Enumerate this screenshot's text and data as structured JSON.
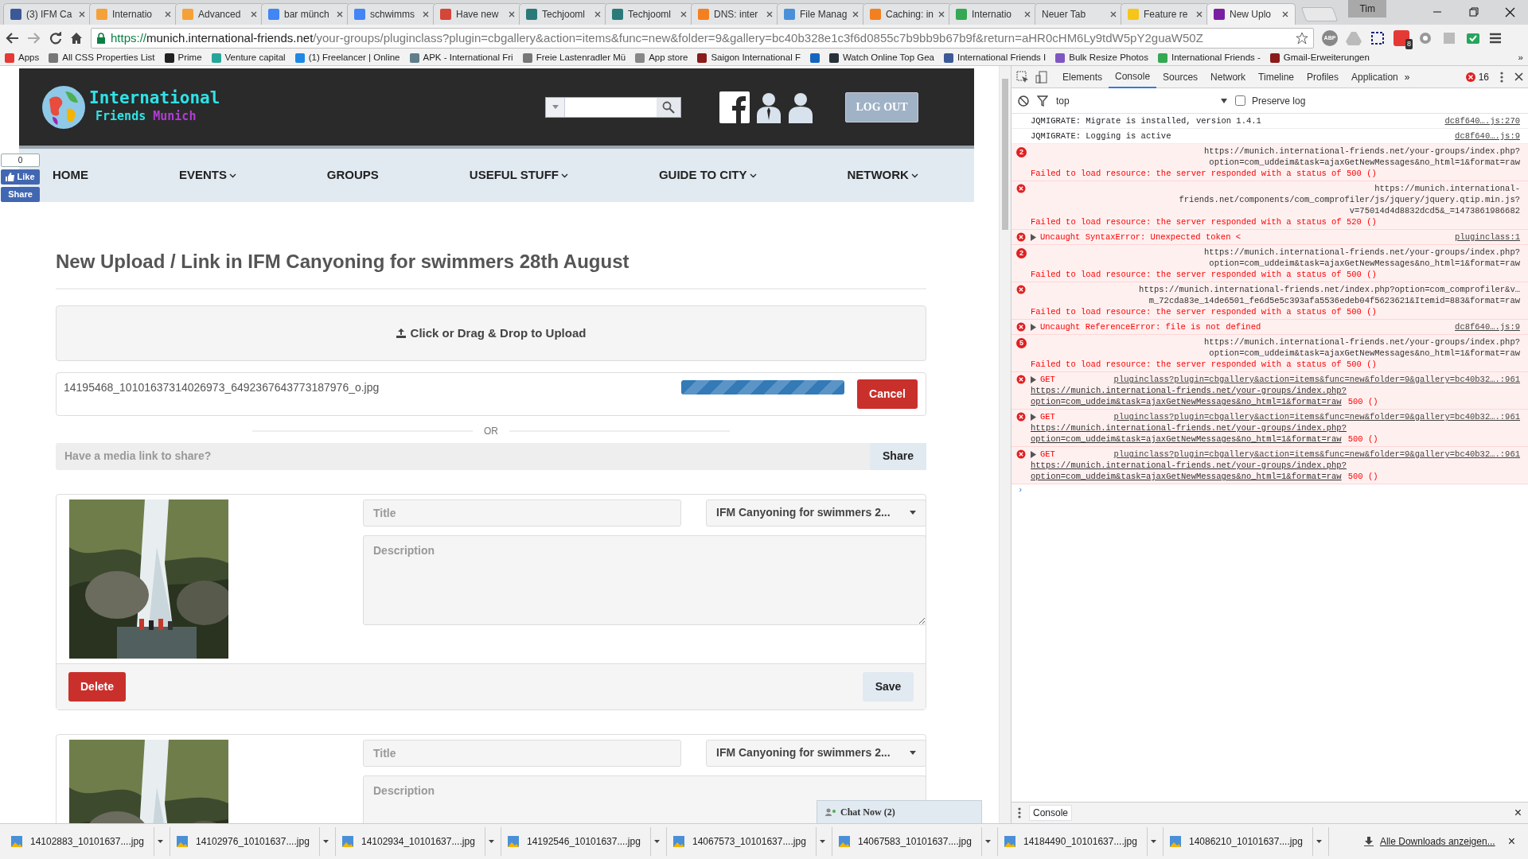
{
  "browser": {
    "tabs": [
      {
        "title": "(3) IFM Ca",
        "color": "#3b5998",
        "selected": false
      },
      {
        "title": "Internatio",
        "color": "#f4a13a",
        "selected": false
      },
      {
        "title": "Advanced",
        "color": "#f4a13a",
        "selected": false
      },
      {
        "title": "bar münch",
        "color": "#4285f4",
        "selected": false
      },
      {
        "title": "schwimms",
        "color": "#4285f4",
        "selected": false
      },
      {
        "title": "Have new",
        "color": "#d44638",
        "selected": false
      },
      {
        "title": "Techjooml",
        "color": "#2a7a7a",
        "selected": false
      },
      {
        "title": "Techjooml",
        "color": "#2a7a7a",
        "selected": false
      },
      {
        "title": "DNS: inter",
        "color": "#f38020",
        "selected": false
      },
      {
        "title": "File Manag",
        "color": "#4a90d9",
        "selected": false
      },
      {
        "title": "Caching: in",
        "color": "#f38020",
        "selected": false
      },
      {
        "title": "Internatio",
        "color": "#34a853",
        "selected": false
      },
      {
        "title": "Neuer Tab",
        "selected": false
      },
      {
        "title": "Feature re",
        "color": "#f5c518",
        "selected": false
      },
      {
        "title": "New Uplo",
        "color": "#7b1fa2",
        "selected": true
      }
    ],
    "profile": "Tim",
    "url_scheme": "https://",
    "url_host": "munich.international-friends.net",
    "url_path": "/your-groups/pluginclass?plugin=cbgallery&action=items&func=new&folder=9&gallery=bc40b328e1c3f6d0855c7b9bb9b67b9f&return=aHR0cHM6Ly9tdW5pY2guaW50Z",
    "abp_label": "ABP",
    "extension_badge": "8",
    "bookmarks": [
      {
        "title": "Apps",
        "color": "#e53935"
      },
      {
        "title": "All CSS Properties List",
        "color": "#777777"
      },
      {
        "title": "Prime",
        "color": "#222222"
      },
      {
        "title": "Venture capital",
        "color": "#26a69a"
      },
      {
        "title": "(1) Freelancer | Online",
        "color": "#1e88e5"
      },
      {
        "title": "APK - International Fri",
        "color": "#607d8b"
      },
      {
        "title": "Freie Lastenradler Mü",
        "color": "#777777"
      },
      {
        "title": "App store",
        "color": "#888888"
      },
      {
        "title": "Saigon International F",
        "color": "#8b1a1a"
      },
      {
        "color": "#1565c0"
      },
      {
        "title": "Watch Online Top Gea",
        "color": "#263238"
      },
      {
        "title": "International Friends I",
        "color": "#3b5998"
      },
      {
        "title": "Bulk Resize Photos",
        "color": "#7e57c2"
      },
      {
        "title": "International Friends -",
        "color": "#34a853"
      },
      {
        "title": "Gmail-Erweiterungen",
        "color": "#8b1a1a"
      }
    ],
    "bookmarks_more": "»"
  },
  "site": {
    "logo_line1": "International",
    "logo_line2a": "Friends",
    "logo_line2b": "Munich",
    "logout": "LOG OUT",
    "like_count": "0",
    "like": "Like",
    "share": "Share",
    "nav": [
      {
        "label": "HOME",
        "dropdown": false
      },
      {
        "label": "EVENTS",
        "dropdown": true
      },
      {
        "label": "GROUPS",
        "dropdown": false
      },
      {
        "label": "USEFUL STUFF",
        "dropdown": true
      },
      {
        "label": "GUIDE TO CITY",
        "dropdown": true
      },
      {
        "label": "NETWORK",
        "dropdown": true
      }
    ]
  },
  "upload": {
    "title": "New Upload / Link in IFM Canyoning for swimmers 28th August",
    "dropzone": "Click or Drag & Drop to Upload",
    "file": {
      "name": "14195468_10101637314026973_6492367643773187976_o.jpg",
      "level": 1.0,
      "cancel": "Cancel"
    },
    "or": "OR",
    "link_placeholder": "Have a media link to share?",
    "share": "Share",
    "items": [
      {
        "kind": "picture",
        "title_placeholder": "Title",
        "gallery": "IFM Canyoning for swimmers 2...",
        "description_placeholder": "Description",
        "delete": "Delete",
        "save": "Save"
      },
      {
        "kind": "picture",
        "title_placeholder": "Title",
        "gallery": "IFM Canyoning for swimmers 2...",
        "description_placeholder": "Description"
      }
    ],
    "chat": "Chat Now (2)"
  },
  "devtools": {
    "tabs": [
      {
        "label": "Elements",
        "selected": false
      },
      {
        "label": "Console",
        "selected": true
      },
      {
        "label": "Sources",
        "selected": false
      },
      {
        "label": "Network",
        "selected": false
      },
      {
        "label": "Timeline",
        "selected": false
      },
      {
        "label": "Profiles",
        "selected": false
      },
      {
        "label": "Application",
        "selected": false
      }
    ],
    "more": "»",
    "error_count": "16",
    "context": "top",
    "preserve_log": {
      "label": "Preserve log",
      "checked": false
    },
    "messages": [
      {
        "kind": "log",
        "text": "JQMIGRATE: Migrate is installed, version 1.4.1",
        "source": "dc8f640….js:270"
      },
      {
        "kind": "log",
        "text": "JQMIGRATE: Logging is active",
        "source": "dc8f640….js:9"
      },
      {
        "kind": "resource",
        "count": "2",
        "url_lines": [
          "https://munich.international-friends.net/your-groups/index.php?",
          "option=com_uddeim&task=ajaxGetNewMessages&no_html=1&format=raw"
        ],
        "text": "Failed to load resource: the server responded with a status of 500 ()"
      },
      {
        "kind": "resource",
        "url_lines": [
          "https://munich.international-",
          "friends.net/components/com_comprofiler/js/jquery/jquery.qtip.min.js?",
          "v=75014d4d8832dcd5&_=1473861986682"
        ],
        "text": "Failed to load resource: the server responded with a status of 520 ()"
      },
      {
        "kind": "exception",
        "text": "Uncaught SyntaxError: Unexpected token <",
        "source": "pluginclass:1"
      },
      {
        "kind": "resource",
        "count": "2",
        "url_lines": [
          "https://munich.international-friends.net/your-groups/index.php?",
          "option=com_uddeim&task=ajaxGetNewMessages&no_html=1&format=raw"
        ],
        "text": "Failed to load resource: the server responded with a status of 500 ()"
      },
      {
        "kind": "resource",
        "url_lines": [
          "https://munich.international-friends.net/index.php?option=com_comprofiler&v…",
          "m_72cda83e_14de6501_fe6d5e5c393afa5536edeb04f5623621&Itemid=883&format=raw"
        ],
        "text": "Failed to load resource: the server responded with a status of 500 ()"
      },
      {
        "kind": "exception",
        "text": "Uncaught ReferenceError: file is not defined",
        "source": "dc8f640….js:9"
      },
      {
        "kind": "resource",
        "count": "5",
        "url_lines": [
          "https://munich.international-friends.net/your-groups/index.php?",
          "option=com_uddeim&task=ajaxGetNewMessages&no_html=1&format=raw"
        ],
        "text": "Failed to load resource: the server responded with a status of 500 ()"
      },
      {
        "kind": "request",
        "method": "GET",
        "source": "pluginclass?plugin=cbgallery&action=items&func=new&folder=9&gallery=bc40b32….:961",
        "link_lines": [
          "https://munich.international-friends.net/your-groups/index.php?",
          "option=com_uddeim&task=ajaxGetNewMessages&no_html=1&format=raw"
        ],
        "status": "500 ()"
      },
      {
        "kind": "request",
        "method": "GET",
        "source": "pluginclass?plugin=cbgallery&action=items&func=new&folder=9&gallery=bc40b32….:961",
        "link_lines": [
          "https://munich.international-friends.net/your-groups/index.php?",
          "option=com_uddeim&task=ajaxGetNewMessages&no_html=1&format=raw"
        ],
        "status": "500 ()"
      },
      {
        "kind": "request",
        "method": "GET",
        "source": "pluginclass?plugin=cbgallery&action=items&func=new&folder=9&gallery=bc40b32….:961",
        "link_lines": [
          "https://munich.international-friends.net/your-groups/index.php?",
          "option=com_uddeim&task=ajaxGetNewMessages&no_html=1&format=raw"
        ],
        "status": "500 ()"
      }
    ],
    "prompt": "›",
    "drawer_tab": "Console",
    "drawer_close": "×"
  },
  "downloads": {
    "items": [
      "14102883_10101637....jpg",
      "14102976_10101637....jpg",
      "14102934_10101637....jpg",
      "14192546_10101637....jpg",
      "14067573_10101637....jpg",
      "14067583_10101637....jpg",
      "14184490_10101637....jpg",
      "14086210_10101637....jpg"
    ],
    "show_all": "Alle Downloads anzeigen...",
    "close": "×"
  }
}
